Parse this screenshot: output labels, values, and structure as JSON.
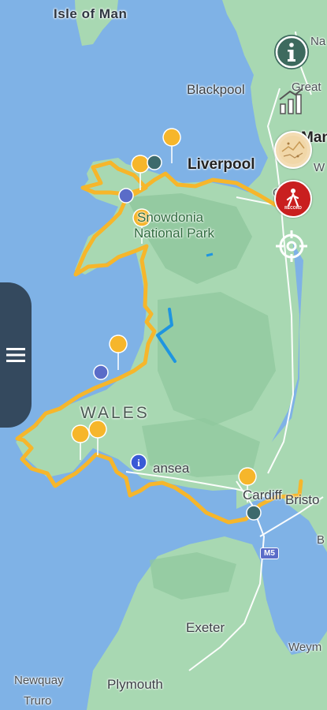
{
  "map": {
    "colors": {
      "sea": "#7fb2e6",
      "land": "#a8d8b2",
      "hills": "#8fc79c",
      "route": "#f6b62b",
      "secondary_route": "#1f95e0",
      "road": "#ffffff"
    },
    "labels": {
      "isle_of_man": "Isle of Man",
      "blackpool": "Blackpool",
      "liverpool": "Liverpool",
      "snowdonia_1": "Snowdonia",
      "snowdonia_2": "National Park",
      "wales": "WALES",
      "swansea": "ansea",
      "cardiff": "Cardiff",
      "bristol": "Bristo",
      "exeter": "Exeter",
      "plymouth": "Plymouth",
      "newquay": "Newquay",
      "truro": "Truro",
      "weymouth": "Weym",
      "manchester_partial": "Man",
      "great_partial": "Great",
      "chester_partial": "Che",
      "na_partial": "Na",
      "w_partial": "W",
      "b_partial": "B"
    },
    "road_shields": {
      "m5": "M5"
    }
  },
  "controls": {
    "info": {
      "icon": "info-icon"
    },
    "elevation": {
      "icon": "elevation-chart-icon"
    },
    "map_layer": {
      "icon": "map-thumbnail-icon"
    },
    "record": {
      "icon": "record-hiker-icon",
      "label": "RECORD"
    },
    "locate": {
      "icon": "crosshair-icon"
    },
    "drawer": {
      "icon": "hamburger-menu-icon"
    }
  }
}
